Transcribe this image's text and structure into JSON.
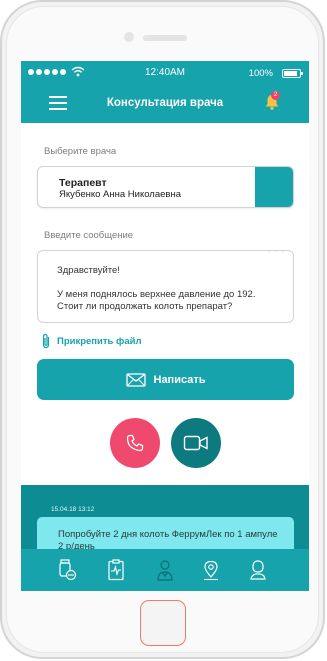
{
  "statusbar": {
    "time": "12:40AM",
    "battery_percent": "100%",
    "signal_icon": "signal-dots-icon",
    "wifi_icon": "wifi-icon",
    "battery_icon": "battery-icon"
  },
  "header": {
    "title": "Консультация врача",
    "menu_icon": "hamburger-menu-icon",
    "notification_icon": "bell-icon",
    "notification_count": "2"
  },
  "doctor": {
    "label": "Выберите врача",
    "specialty": "Терапевт",
    "name": "Якубенко Анна Николаевна"
  },
  "message": {
    "label": "Введите сообщение",
    "greeting": "Здравствуйте!",
    "text": "У меня поднялось верхнее давление до 192. Стоит ли продолжать колоть препарат?"
  },
  "attach": {
    "label": "Прикрепить файл",
    "icon": "paperclip-icon"
  },
  "actions": {
    "write_label": "Написать",
    "write_icon": "envelope-icon",
    "call_icon": "phone-icon",
    "video_icon": "video-camera-icon"
  },
  "chat": {
    "date": "15.04.18  13:12",
    "text": "Попробуйте 2 дня колоть ФеррумЛек по 1 ампуле 2 р/день"
  },
  "tabbar": {
    "items": [
      {
        "icon": "pills-icon"
      },
      {
        "icon": "medical-card-icon"
      },
      {
        "icon": "doctor-icon"
      },
      {
        "icon": "map-pin-icon"
      },
      {
        "icon": "user-profile-icon"
      }
    ]
  },
  "colors": {
    "primary": "#16a3ab",
    "dark_teal": "#0d7a80",
    "call_red": "#ef4a6d",
    "bubble": "#7fe8ee",
    "badge": "#e8476a"
  }
}
